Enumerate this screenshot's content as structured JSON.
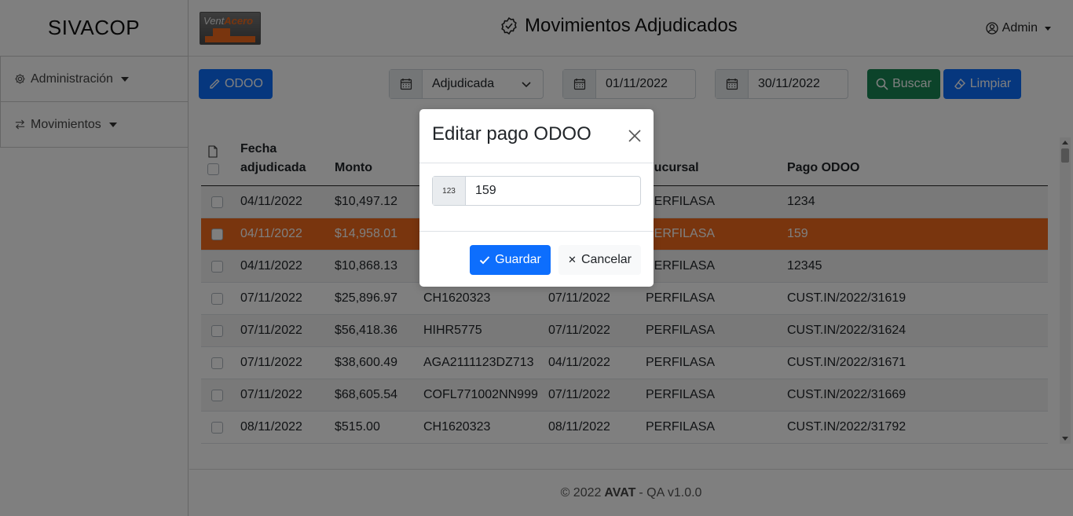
{
  "app": {
    "brand": "SIVACOP",
    "logo_text_a": "Vent",
    "logo_text_b": "Acero"
  },
  "sidebar": {
    "items": [
      {
        "label": "Administración",
        "icon": "gear-icon"
      },
      {
        "label": "Movimientos",
        "icon": "arrows-exchange-icon"
      }
    ]
  },
  "header": {
    "title": "Movimientos Adjudicados",
    "user": "Admin"
  },
  "toolbar": {
    "odoo_label": "ODOO",
    "status_value": "Adjudicada",
    "date_from": "01/11/2022",
    "date_to": "30/11/2022",
    "search_label": "Buscar",
    "clear_label": "Limpiar"
  },
  "table": {
    "headers": {
      "fecha_1": "Fecha",
      "fecha_2": "adjudicada",
      "monto": "Monto",
      "sucursal": "Sucursal",
      "pago": "Pago ODOO"
    },
    "rows": [
      {
        "fecha": "04/11/2022",
        "monto": "$10,497.12",
        "ref": "",
        "fecha2": "",
        "sucursal": "PERFILASA",
        "pago": "1234"
      },
      {
        "fecha": "04/11/2022",
        "monto": "$14,958.01",
        "ref": "",
        "fecha2": "",
        "sucursal": "PERFILASA",
        "pago": "159"
      },
      {
        "fecha": "04/11/2022",
        "monto": "$10,868.13",
        "ref": "",
        "fecha2": "",
        "sucursal": "PERFILASA",
        "pago": "12345"
      },
      {
        "fecha": "07/11/2022",
        "monto": "$25,896.97",
        "ref": "CH1620323",
        "fecha2": "07/11/2022",
        "sucursal": "PERFILASA",
        "pago": "CUST.IN/2022/31619"
      },
      {
        "fecha": "07/11/2022",
        "monto": "$56,418.36",
        "ref": "HIHR5775",
        "fecha2": "07/11/2022",
        "sucursal": "PERFILASA",
        "pago": "CUST.IN/2022/31624"
      },
      {
        "fecha": "07/11/2022",
        "monto": "$38,600.49",
        "ref": "AGA2111123DZ713",
        "fecha2": "04/11/2022",
        "sucursal": "PERFILASA",
        "pago": "CUST.IN/2022/31671"
      },
      {
        "fecha": "07/11/2022",
        "monto": "$68,605.54",
        "ref": "COFL771002NN999",
        "fecha2": "07/11/2022",
        "sucursal": "PERFILASA",
        "pago": "CUST.IN/2022/31669"
      },
      {
        "fecha": "08/11/2022",
        "monto": "$515.00",
        "ref": "CH1620323",
        "fecha2": "08/11/2022",
        "sucursal": "PERFILASA",
        "pago": "CUST.IN/2022/31792"
      }
    ]
  },
  "footer": {
    "copy": "© 2022",
    "company": "AVAT",
    "version": "- QA v1.0.0"
  },
  "modal": {
    "title": "Editar pago ODOO",
    "input_prefix": "123",
    "input_value": "159",
    "save_label": "Guardar",
    "cancel_label": "Cancelar"
  },
  "colors": {
    "primary": "#0d6efd",
    "success": "#198754",
    "selected_row": "#f26b1d"
  }
}
